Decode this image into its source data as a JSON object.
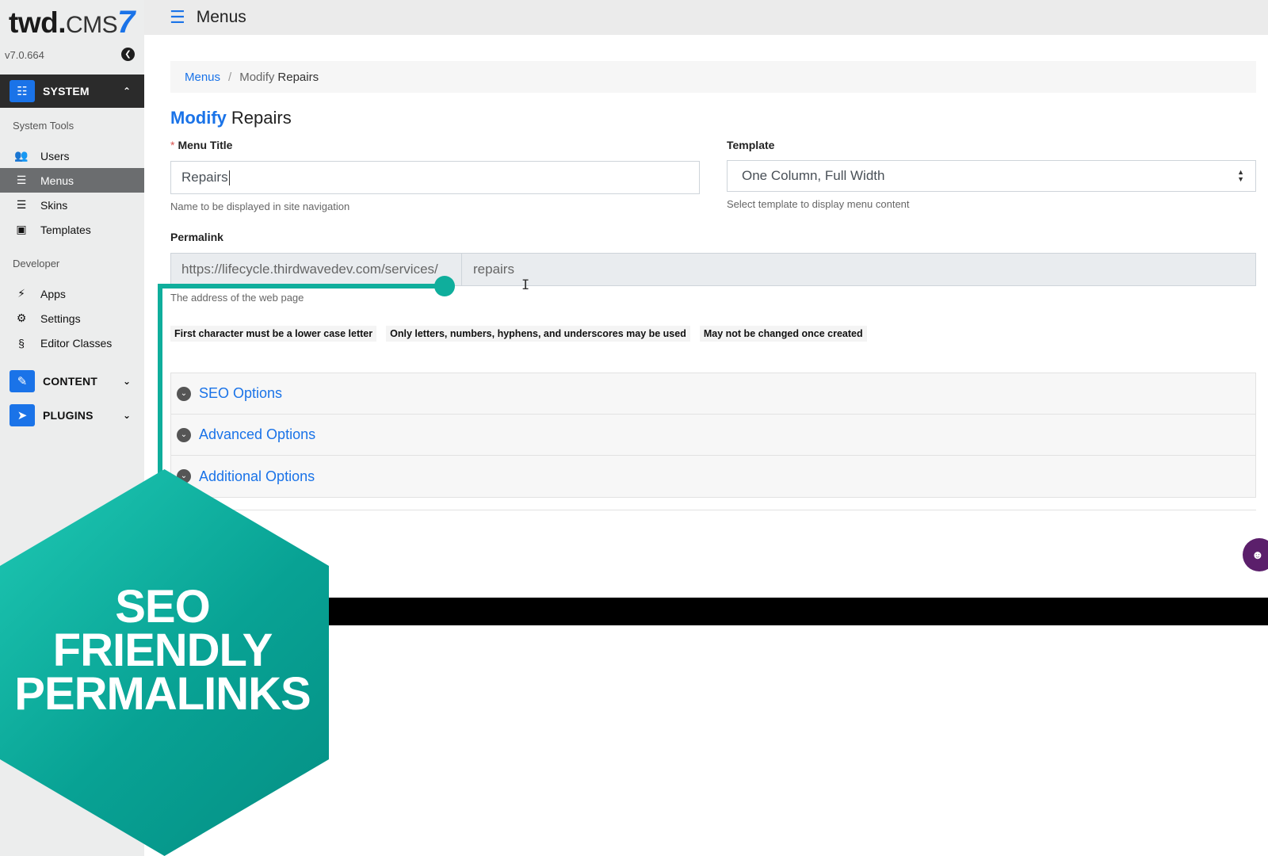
{
  "sidebar": {
    "logo": {
      "twd": "twd",
      "dot": ".",
      "cms": "CMS",
      "seven": "7"
    },
    "version": "v7.0.664",
    "collapse_icon": "chevron-left-circle-icon",
    "sections": {
      "system": {
        "label": "SYSTEM",
        "icon": "sitemap-icon"
      },
      "content": {
        "label": "CONTENT",
        "icon": "edit-icon"
      },
      "plugins": {
        "label": "PLUGINS",
        "icon": "rocket-icon"
      }
    },
    "groups": {
      "system_tools": "System Tools",
      "developer": "Developer"
    },
    "items": {
      "users": "Users",
      "menus": "Menus",
      "skins": "Skins",
      "templates": "Templates",
      "apps": "Apps",
      "settings": "Settings",
      "editor_classes": "Editor Classes"
    }
  },
  "topbar": {
    "title": "Menus",
    "icon": "list-icon"
  },
  "breadcrumb": {
    "link": "Menus",
    "separator": "/",
    "muted": "Modify",
    "current": "Repairs"
  },
  "page_title": {
    "action": "Modify",
    "name": "Repairs"
  },
  "form": {
    "menu_title": {
      "required_mark": "*",
      "label": "Menu Title",
      "value": "Repairs",
      "help": "Name to be displayed in site navigation"
    },
    "template": {
      "label": "Template",
      "value": "One Column, Full Width",
      "help": "Select template to display menu content"
    },
    "permalink": {
      "label": "Permalink",
      "prefix": "https://lifecycle.thirdwavedev.com/services/",
      "slug": "repairs",
      "help": "The address of the web page",
      "rules": [
        "First character must be a lower case letter",
        "Only letters, numbers, hyphens, and underscores may be used",
        "May not be changed once created"
      ]
    }
  },
  "accordion": [
    "SEO Options",
    "Advanced Options",
    "Additional Options"
  ],
  "overlay": {
    "lines": [
      "SEO",
      "FRIENDLY",
      "PERMALINKS"
    ]
  },
  "colors": {
    "accent": "#1a73e8",
    "teal": "#08a294",
    "ghost": "#5b1f6b",
    "sidebar_active": "#2b2b2b"
  }
}
